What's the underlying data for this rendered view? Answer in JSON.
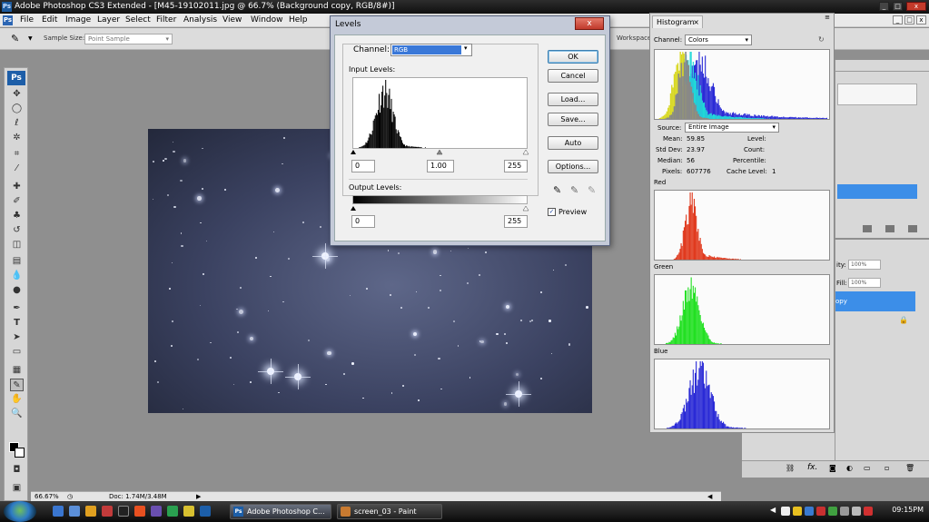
{
  "window": {
    "title": "Adobe Photoshop CS3 Extended - [M45-19102011.jpg @ 66.7% (Background copy, RGB/8#)]"
  },
  "menu": [
    "File",
    "Edit",
    "Image",
    "Layer",
    "Select",
    "Filter",
    "Analysis",
    "View",
    "Window",
    "Help"
  ],
  "options_bar": {
    "sample_size_label": "Sample Size:",
    "sample_size_value": "Point Sample",
    "workspace_label": "Workspace"
  },
  "levels": {
    "title": "Levels",
    "channel_label": "Channel:",
    "channel_value": "RGB",
    "input_levels_label": "Input Levels:",
    "input_black": "0",
    "input_gamma": "1.00",
    "input_white": "255",
    "output_levels_label": "Output Levels:",
    "output_black": "0",
    "output_white": "255",
    "buttons": {
      "ok": "OK",
      "cancel": "Cancel",
      "load": "Load...",
      "save": "Save...",
      "auto": "Auto",
      "options": "Options..."
    },
    "preview_label": "Preview",
    "preview_checked": true
  },
  "histogram": {
    "tab": "Histogram",
    "channel_label": "Channel:",
    "channel_value": "Colors",
    "source_label": "Source:",
    "source_value": "Entire Image",
    "stats": {
      "mean_label": "Mean:",
      "mean": "59.85",
      "stddev_label": "Std Dev:",
      "stddev": "23.97",
      "median_label": "Median:",
      "median": "56",
      "pixels_label": "Pixels:",
      "pixels": "607776",
      "level_label": "Level:",
      "count_label": "Count:",
      "percentile_label": "Percentile:",
      "cache_label": "Cache Level:",
      "cache": "1"
    },
    "channels": {
      "red": "Red",
      "green": "Green",
      "blue": "Blue"
    },
    "colors": {
      "red": "#e03a1e",
      "green": "#22e022",
      "blue": "#2a2ad6"
    }
  },
  "panels": {
    "opacity_label": "ity:",
    "opacity_value": "100%",
    "fill_label": "Fill:",
    "fill_value": "100%",
    "layer_label": "opy"
  },
  "status": {
    "zoom": "66.67%",
    "doc": "Doc: 1.74M/3.48M"
  },
  "taskbar": {
    "tasks": [
      "Adobe Photoshop C...",
      "screen_03 - Paint"
    ],
    "clock": "09:15PM"
  }
}
